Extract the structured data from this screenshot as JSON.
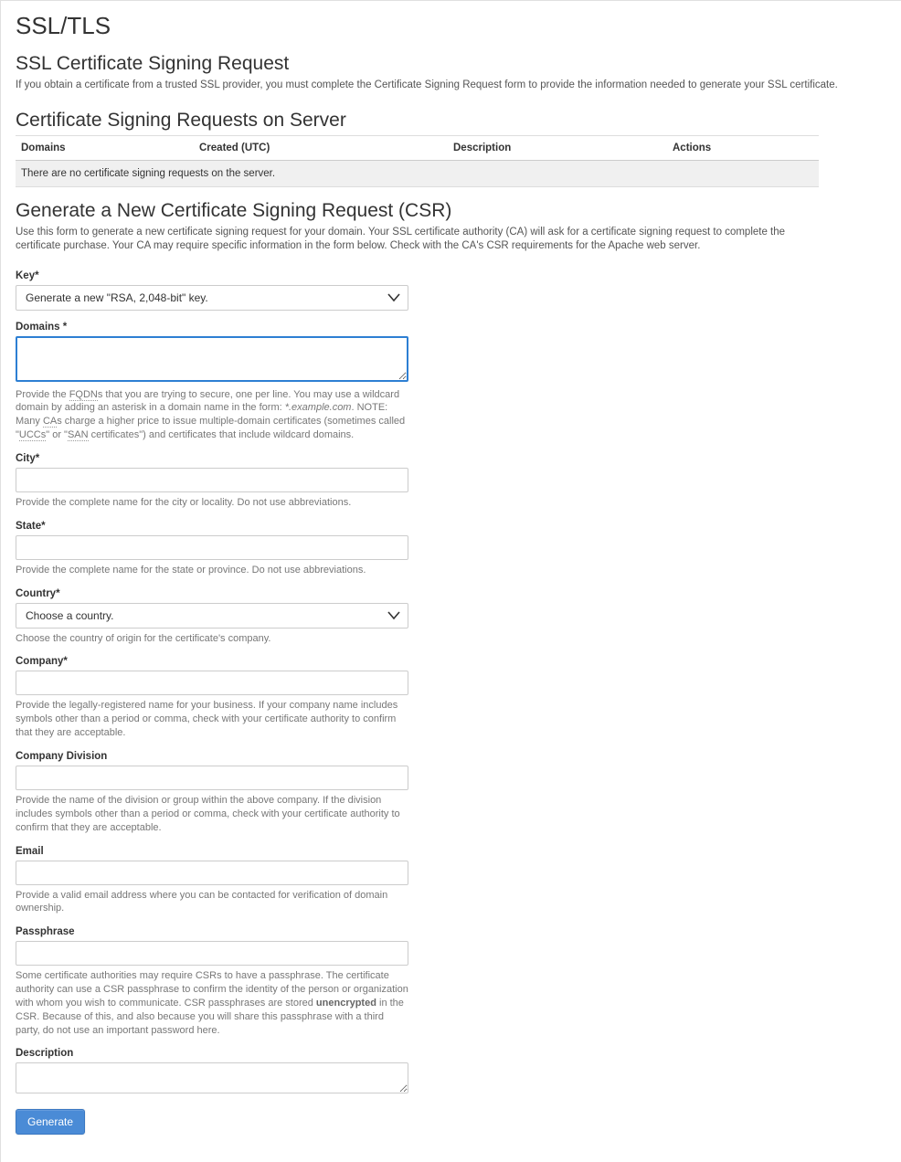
{
  "page": {
    "title": "SSL/TLS"
  },
  "section_csr_req": {
    "title": "SSL Certificate Signing Request",
    "intro": "If you obtain a certificate from a trusted SSL provider, you must complete the Certificate Signing Request form to provide the information needed to generate your SSL certificate."
  },
  "section_on_server": {
    "title": "Certificate Signing Requests on Server",
    "columns": {
      "c0": "Domains",
      "c1": "Created (UTC)",
      "c2": "Description",
      "c3": "Actions"
    },
    "empty_row": "There are no certificate signing requests on the server."
  },
  "section_generate": {
    "title": "Generate a New Certificate Signing Request (CSR)",
    "intro": "Use this form to generate a new certificate signing request for your domain. Your SSL certificate authority (CA) will ask for a certificate signing request to complete the certificate purchase. Your CA may require specific information in the form below. Check with the CA's CSR requirements for the Apache web server."
  },
  "form": {
    "key": {
      "label": "Key*",
      "selected": "Generate a new \"RSA, 2,048-bit\" key."
    },
    "domains": {
      "label": "Domains *",
      "value": "",
      "hint_pre": "Provide the ",
      "hint_fqdn": "FQDN",
      "hint_mid1": "s that you are trying to secure, one per line. You may use a wildcard domain by adding an asterisk in a domain name in the form: ",
      "hint_example": "*.example.com",
      "hint_mid2": ". NOTE: Many ",
      "hint_ca": "CA",
      "hint_mid3": "s charge a higher price to issue multiple-domain certificates (sometimes called \"",
      "hint_ucc": "UCCs",
      "hint_mid4": "\" or \"",
      "hint_san": "SAN",
      "hint_end": " certificates\") and certificates that include wildcard domains."
    },
    "city": {
      "label": "City*",
      "value": "",
      "hint": "Provide the complete name for the city or locality. Do not use abbreviations."
    },
    "state": {
      "label": "State*",
      "value": "",
      "hint": "Provide the complete name for the state or province. Do not use abbreviations."
    },
    "country": {
      "label": "Country*",
      "selected": "Choose a country.",
      "hint": "Choose the country of origin for the certificate's company."
    },
    "company": {
      "label": "Company*",
      "value": "",
      "hint": "Provide the legally-registered name for your business. If your company name includes symbols other than a period or comma, check with your certificate authority to confirm that they are acceptable."
    },
    "company_division": {
      "label": "Company Division",
      "value": "",
      "hint": "Provide the name of the division or group within the above company. If the division includes symbols other than a period or comma, check with your certificate authority to confirm that they are acceptable."
    },
    "email": {
      "label": "Email",
      "value": "",
      "hint": "Provide a valid email address where you can be contacted for verification of domain ownership."
    },
    "passphrase": {
      "label": "Passphrase",
      "value": "",
      "hint_pre": "Some certificate authorities may require CSRs to have a passphrase. The certificate authority can use a CSR passphrase to confirm the identity of the person or organization with whom you wish to communicate. CSR passphrases are stored ",
      "hint_bold": "unencrypted",
      "hint_post": " in the CSR. Because of this, and also because you will share this passphrase with a third party, do not use an important password here."
    },
    "description": {
      "label": "Description",
      "value": ""
    },
    "submit": "Generate"
  }
}
